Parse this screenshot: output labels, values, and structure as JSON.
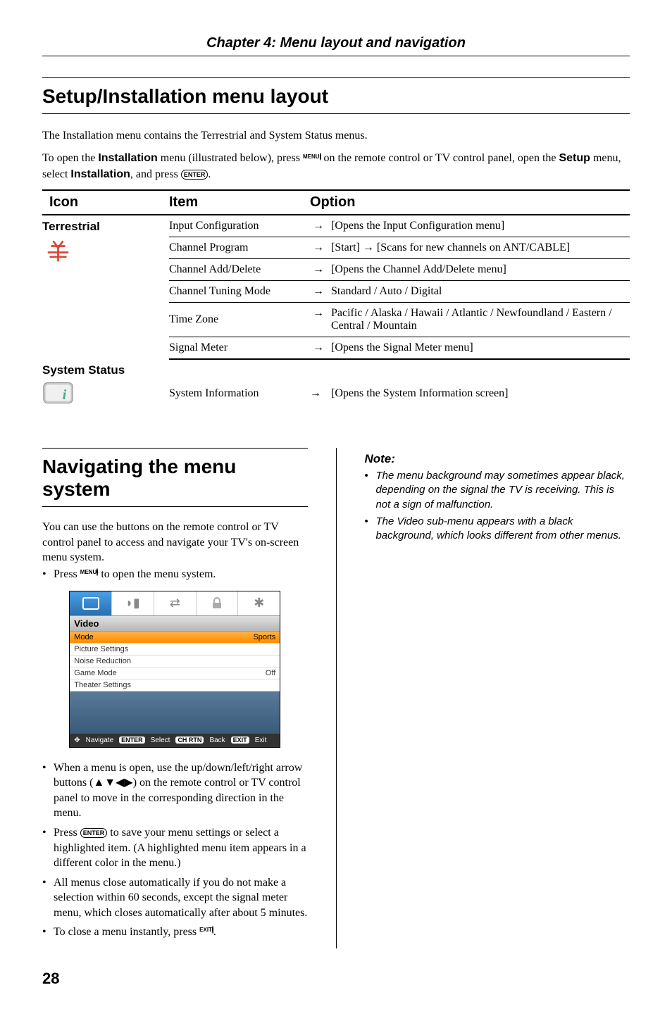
{
  "chapter_title": "Chapter 4: Menu layout and navigation",
  "section1_title": "Setup/Installation menu layout",
  "intro_line1": "The Installation menu contains the Terrestrial and System Status menus.",
  "intro_open": "To open the ",
  "intro_installation": "Installation",
  "intro_menu_illus": " menu (illustrated below), press ",
  "menu_btn_label": "MENU",
  "intro_remote": " on the remote control or TV control panel, open the ",
  "intro_setup": "Setup",
  "intro_select": " menu, select ",
  "intro_installation2": "Installation",
  "intro_press": ", and press ",
  "enter_label": "ENTER",
  "period": ".",
  "table": {
    "h_icon": "Icon",
    "h_item": "Item",
    "h_option": "Option",
    "cat_terrestrial": "Terrestrial",
    "cat_system": "System Status",
    "rows": [
      {
        "item": "Input Configuration",
        "option": "[Opens the Input Configuration menu]"
      },
      {
        "item": "Channel Program",
        "option": "[Start] → [Scans for new channels on ANT/CABLE]"
      },
      {
        "item": "Channel Add/Delete",
        "option": "[Opens the Channel Add/Delete menu]"
      },
      {
        "item": "Channel Tuning Mode",
        "option": "Standard / Auto / Digital"
      },
      {
        "item": "Time Zone",
        "option": "Pacific / Alaska / Hawaii / Atlantic / Newfoundland / Eastern / Central / Mountain"
      },
      {
        "item": "Signal Meter",
        "option": "[Opens the Signal Meter menu]"
      }
    ],
    "sys_item": "System Information",
    "sys_option": "[Opens the System Information screen]"
  },
  "arrow": "→",
  "section2_title": "Navigating the menu system",
  "nav_intro": "You can use the buttons on the remote control or TV control panel to access and navigate your TV's on-screen menu system.",
  "nav_bullet1_a": "Press ",
  "nav_bullet1_b": " to open the menu system.",
  "nav_bullet2": "When a menu is open, use the up/down/left/right arrow buttons (▲▼◀▶) on the remote control or TV control panel to move in the corresponding direction in the menu.",
  "nav_bullet3_a": "Press ",
  "nav_bullet3_b": " to save your menu settings or select a highlighted item. (A highlighted menu item appears in a different color in the menu.)",
  "nav_bullet4": "All menus close automatically if you do not make a selection within 60 seconds, except the signal meter menu, which closes automatically after about 5 minutes.",
  "nav_bullet5_a": "To close a menu instantly, press ",
  "exit_btn_label": "EXIT",
  "nav_bullet5_b": ".",
  "note_title": "Note:",
  "note1": "The menu background may sometimes appear black, depending on the signal the TV is receiving. This is not a sign of malfunction.",
  "note2": "The Video sub-menu appears with a black background, which looks different from other menus.",
  "menu_screenshot": {
    "category": "Video",
    "rows": [
      {
        "label": "Mode",
        "value": "Sports"
      },
      {
        "label": "Picture Settings",
        "value": ""
      },
      {
        "label": "Noise Reduction",
        "value": ""
      },
      {
        "label": "Game Mode",
        "value": "Off"
      },
      {
        "label": "Theater Settings",
        "value": ""
      }
    ],
    "footer_navigate": "Navigate",
    "footer_enter_badge": "ENTER",
    "footer_select": "Select",
    "footer_chrtn_badge": "CH RTN",
    "footer_back": "Back",
    "footer_exit_badge": "EXIT",
    "footer_exit": "Exit"
  },
  "page_number": "28"
}
